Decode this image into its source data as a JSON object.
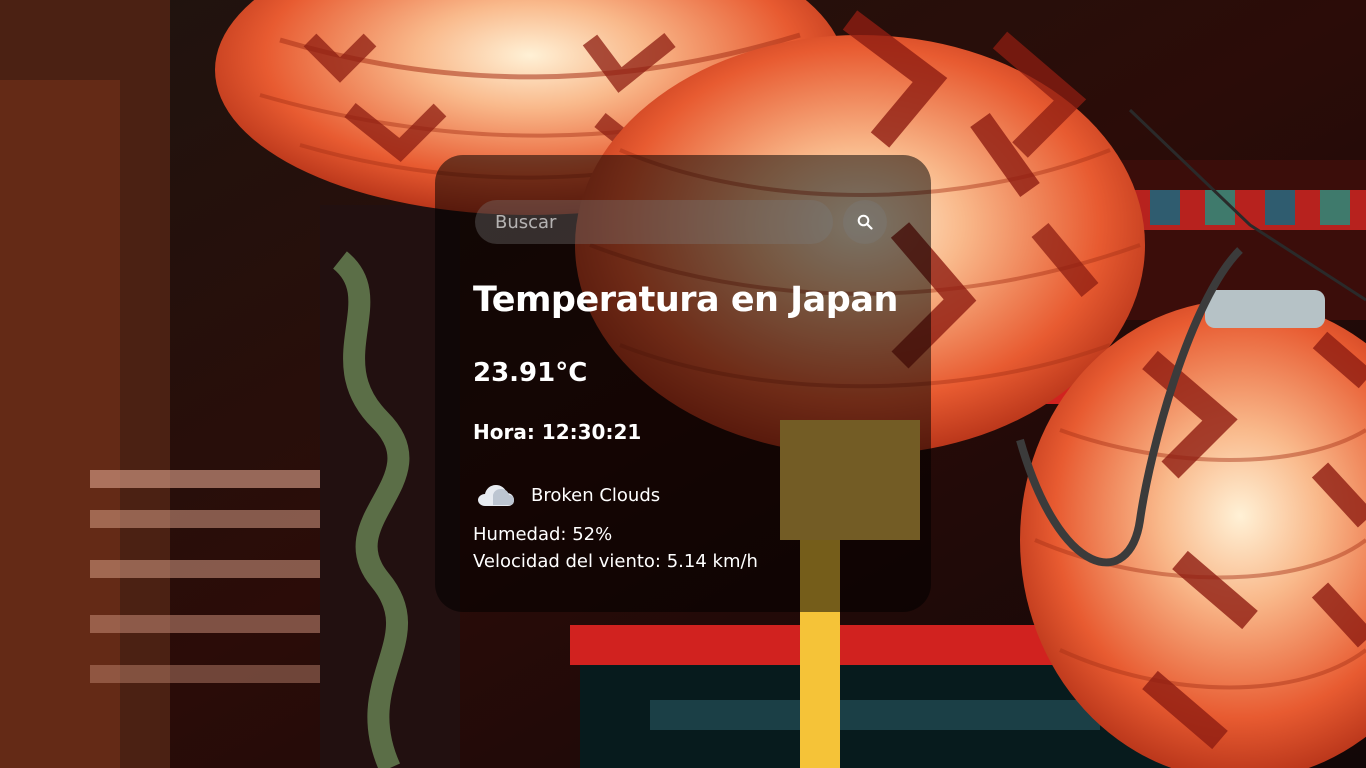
{
  "search": {
    "placeholder": "Buscar",
    "icon": "search-icon"
  },
  "weather": {
    "title": "Temperatura en Japan",
    "temperature": "23.91°C",
    "time": "Hora: 12:30:21",
    "icon": "cloud-icon",
    "description": "Broken Clouds",
    "humidity": "Humedad: 52%",
    "wind": "Velocidad del viento: 5.14 km/h"
  },
  "colors": {
    "card_background": "rgba(0,0,0,0.52)",
    "text": "#ffffff",
    "search_background": "rgba(124,124,124,0.35)",
    "lantern": "#e8582a"
  }
}
